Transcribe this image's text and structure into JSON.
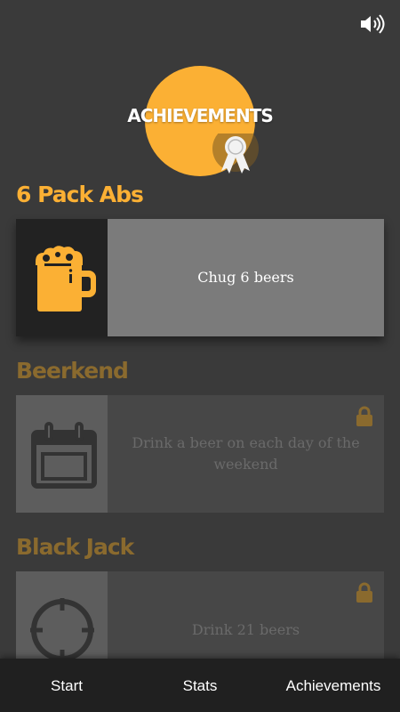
{
  "header": {
    "title": "ACHIEVEMENTS",
    "sound_icon": "speaker-volume-icon",
    "badge_icon": "award-ribbon-icon"
  },
  "achievements": [
    {
      "name": "6 Pack Abs",
      "description": "Chug 6 beers",
      "icon": "beer-mug-icon",
      "locked": false
    },
    {
      "name": "Beerkend",
      "description": "Drink a beer on each day of the weekend",
      "icon": "calendar-icon",
      "locked": true
    },
    {
      "name": "Black Jack",
      "description": "Drink 21 beers",
      "icon": "crosshair-icon",
      "locked": true
    }
  ],
  "tabs": [
    {
      "label": "Start"
    },
    {
      "label": "Stats"
    },
    {
      "label": "Achievements"
    }
  ],
  "colors": {
    "accent": "#fbb034",
    "accent_dim": "#8a6a2e",
    "background": "#3a3a3a",
    "tabbar": "#202020"
  }
}
